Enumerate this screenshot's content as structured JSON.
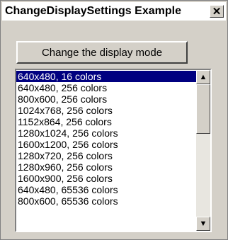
{
  "window": {
    "title": "ChangeDisplaySettings Example",
    "close_glyph": "✕"
  },
  "main": {
    "button_label": "Change the display mode"
  },
  "list": {
    "items": [
      "640x480, 16 colors",
      "640x480, 256 colors",
      "800x600, 256 colors",
      "1024x768, 256 colors",
      "1152x864, 256 colors",
      "1280x1024, 256 colors",
      "1600x1200, 256 colors",
      "1280x720, 256 colors",
      "1280x960, 256 colors",
      "1600x900, 256 colors",
      "640x480, 65536 colors",
      "800x600, 65536 colors"
    ],
    "selected_index": 0
  },
  "scrollbar": {
    "up_glyph": "▲",
    "down_glyph": "▼"
  },
  "colors": {
    "selection": "#000080",
    "face": "#d4d0c8"
  }
}
